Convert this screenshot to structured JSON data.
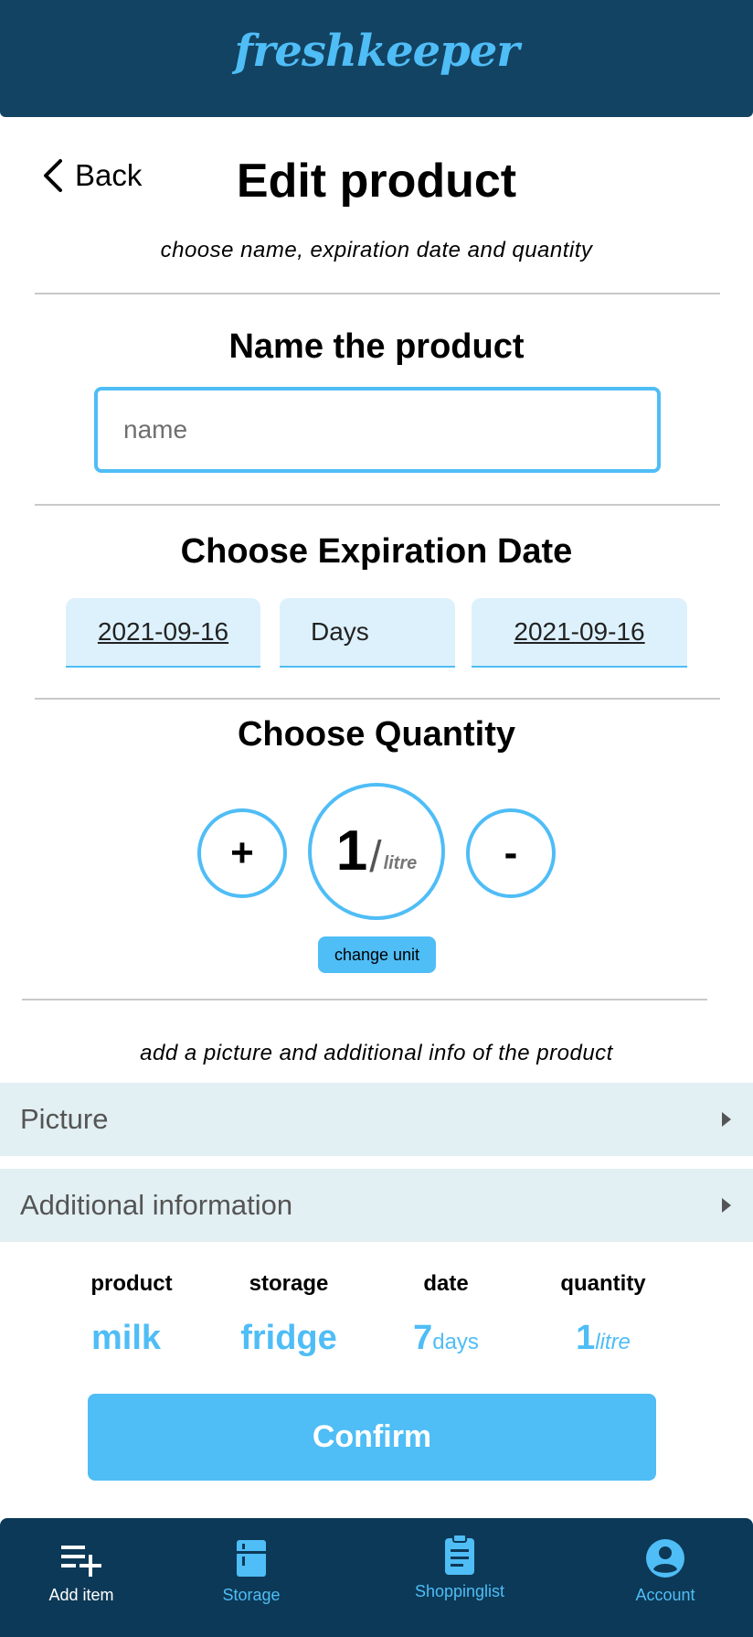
{
  "header": {
    "brand": "freshkeeper"
  },
  "page": {
    "back_label": "Back",
    "title": "Edit product",
    "subtitle": "choose name, expiration date and quantity"
  },
  "name_section": {
    "title": "Name the product",
    "placeholder": "name",
    "value": ""
  },
  "expiration_section": {
    "title": "Choose Expiration Date",
    "start_date": "2021-09-16",
    "unit": "Days",
    "end_date": "2021-09-16"
  },
  "quantity_section": {
    "title": "Choose Quantity",
    "plus_label": "+",
    "minus_label": "-",
    "value": "1",
    "slash": "/",
    "unit": "litre",
    "change_unit_label": "change unit"
  },
  "extra": {
    "info_text": "add a picture and additional info of the product",
    "accordions": [
      {
        "label": "Picture"
      },
      {
        "label": "Additional information"
      }
    ]
  },
  "summary": {
    "headers": {
      "product": "product",
      "storage": "storage",
      "date": "date",
      "quantity": "quantity"
    },
    "values": {
      "product": "milk",
      "storage": "fridge",
      "date_num": "7",
      "date_unit": "days",
      "quantity_num": "1",
      "quantity_unit": "litre"
    }
  },
  "confirm_label": "Confirm",
  "nav": {
    "items": [
      {
        "label": "Add item",
        "icon": "add-list-icon",
        "active": true
      },
      {
        "label": "Storage",
        "icon": "storage-icon",
        "active": false
      },
      {
        "label": "Shoppinglist",
        "icon": "clipboard-icon",
        "active": false
      },
      {
        "label": "Account",
        "icon": "account-icon",
        "active": false
      }
    ]
  },
  "colors": {
    "header": "#134362",
    "accent": "#4fbdf6",
    "nav": "#0c3957",
    "accordion": "#e2eff3",
    "date_box": "#ddf1fc"
  }
}
